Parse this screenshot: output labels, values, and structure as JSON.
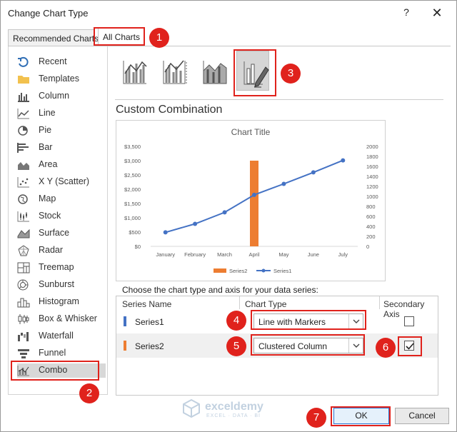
{
  "window": {
    "title": "Change Chart Type",
    "help_label": "?",
    "close_label": "✕"
  },
  "tabs": {
    "recommended": "Recommended Charts",
    "all": "All Charts"
  },
  "callouts": [
    "1",
    "2",
    "3",
    "4",
    "5",
    "6",
    "7"
  ],
  "sidebar": {
    "items": [
      {
        "label": "Recent",
        "icon": "recent-icon"
      },
      {
        "label": "Templates",
        "icon": "templates-folder-icon"
      },
      {
        "label": "Column",
        "icon": "column-chart-icon"
      },
      {
        "label": "Line",
        "icon": "line-chart-icon"
      },
      {
        "label": "Pie",
        "icon": "pie-chart-icon"
      },
      {
        "label": "Bar",
        "icon": "bar-chart-icon"
      },
      {
        "label": "Area",
        "icon": "area-chart-icon"
      },
      {
        "label": "X Y (Scatter)",
        "icon": "scatter-chart-icon"
      },
      {
        "label": "Map",
        "icon": "map-chart-icon"
      },
      {
        "label": "Stock",
        "icon": "stock-chart-icon"
      },
      {
        "label": "Surface",
        "icon": "surface-chart-icon"
      },
      {
        "label": "Radar",
        "icon": "radar-chart-icon"
      },
      {
        "label": "Treemap",
        "icon": "treemap-chart-icon"
      },
      {
        "label": "Sunburst",
        "icon": "sunburst-chart-icon"
      },
      {
        "label": "Histogram",
        "icon": "histogram-chart-icon"
      },
      {
        "label": "Box & Whisker",
        "icon": "box-whisker-chart-icon"
      },
      {
        "label": "Waterfall",
        "icon": "waterfall-chart-icon"
      },
      {
        "label": "Funnel",
        "icon": "funnel-chart-icon"
      },
      {
        "label": "Combo",
        "icon": "combo-chart-icon"
      }
    ],
    "selected": "Combo"
  },
  "combo_types": [
    {
      "icon": "clustered-column-line-icon"
    },
    {
      "icon": "clustered-column-line-secondary-axis-icon"
    },
    {
      "icon": "stacked-area-clustered-column-icon"
    },
    {
      "icon": "custom-combination-icon",
      "selected": true
    }
  ],
  "section_title": "Custom Combination",
  "chart_data": {
    "type": "combo",
    "title": "Chart Title",
    "categories": [
      "January",
      "February",
      "March",
      "April",
      "May",
      "June",
      "July"
    ],
    "primary_axis": {
      "ticks": [
        "$0",
        "$500",
        "$1,000",
        "$1,500",
        "$2,000",
        "$2,500",
        "$3,000",
        "$3,500"
      ],
      "ylim": [
        0,
        3500
      ]
    },
    "secondary_axis": {
      "ticks": [
        "0",
        "200",
        "400",
        "600",
        "800",
        "1000",
        "1200",
        "1400",
        "1600",
        "1800",
        "2000"
      ],
      "ylim": [
        0,
        2000
      ]
    },
    "series": [
      {
        "name": "Series2",
        "chart": "column",
        "axis": "primary",
        "color": "#ed7d31",
        "values": [
          null,
          null,
          null,
          3000,
          null,
          null,
          null
        ]
      },
      {
        "name": "Series1",
        "chart": "line-markers",
        "axis": "secondary",
        "color": "#4472c4",
        "values": [
          280,
          450,
          680,
          1030,
          1250,
          1480,
          1720
        ]
      }
    ],
    "legend": "bottom"
  },
  "series_table": {
    "prompt": "Choose the chart type and axis for your data series:",
    "headers": {
      "name": "Series Name",
      "type": "Chart Type",
      "axis": "Secondary Axis"
    },
    "rows": [
      {
        "name": "Series1",
        "color": "#4472c4",
        "chart_type": "Line with Markers",
        "secondary_axis": false
      },
      {
        "name": "Series2",
        "color": "#ed7d31",
        "chart_type": "Clustered Column",
        "secondary_axis": true
      }
    ]
  },
  "watermark": {
    "title": "exceldemy",
    "subtitle": "EXCEL · DATA · BI"
  },
  "buttons": {
    "ok": "OK",
    "cancel": "Cancel"
  }
}
